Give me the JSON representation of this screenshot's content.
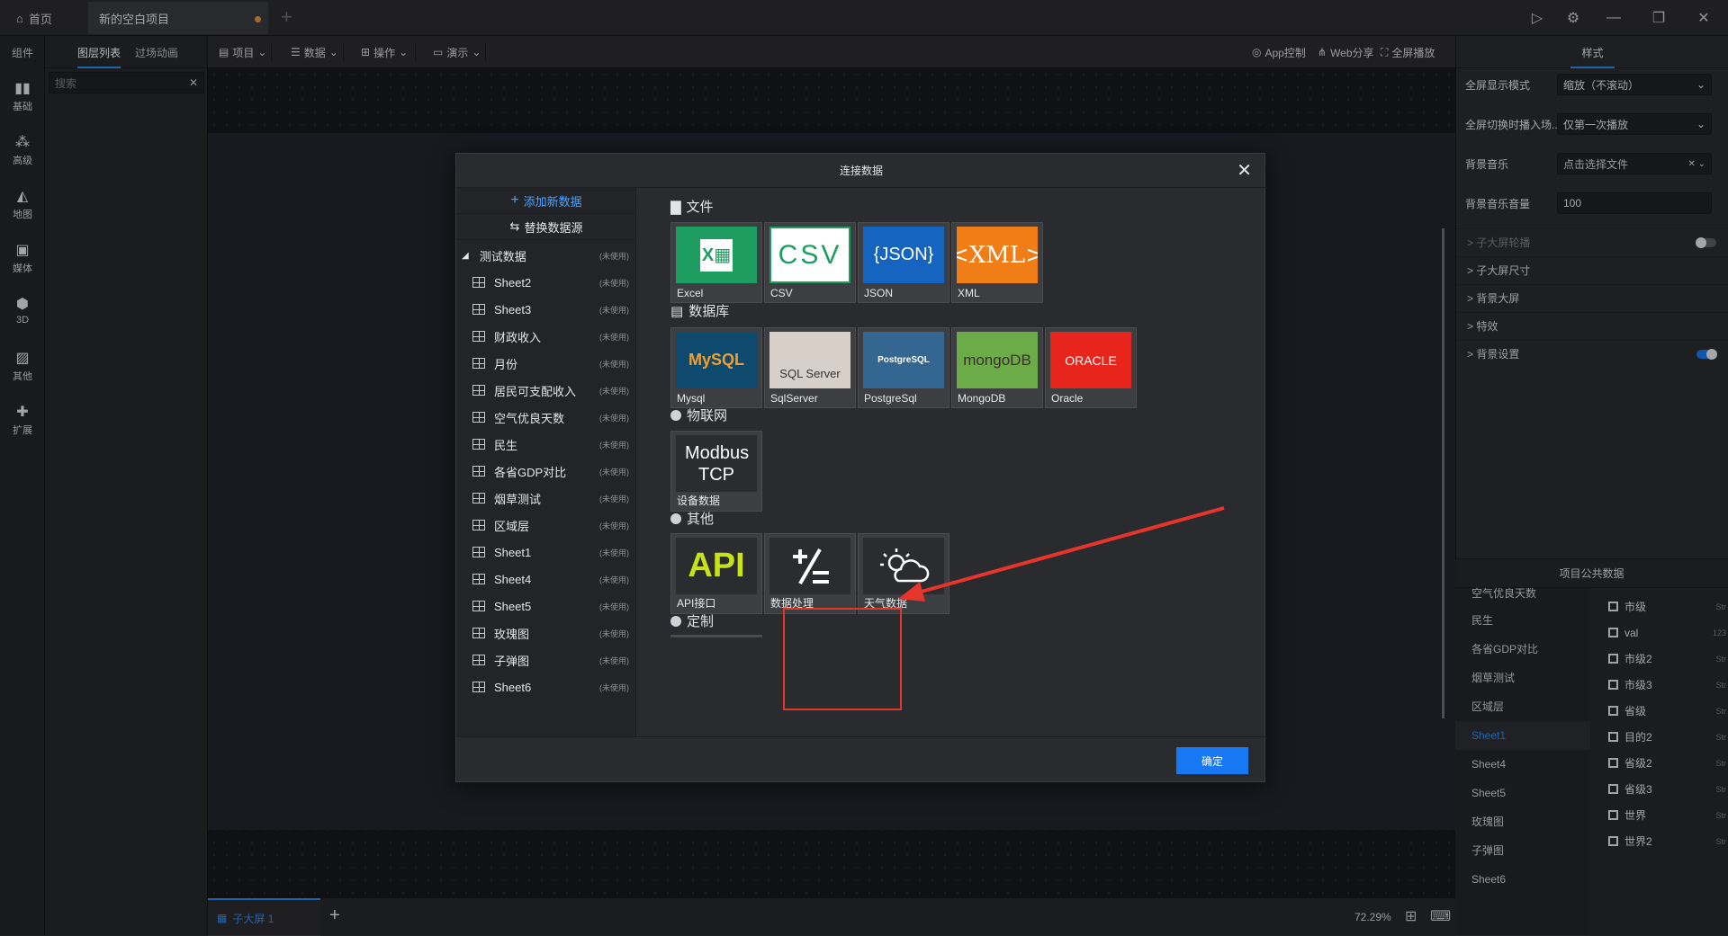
{
  "titlebar": {
    "home_label": "首页",
    "project_tab": "新的空白项目",
    "add_tab": "+"
  },
  "leftbar": {
    "title": "组件",
    "items": [
      {
        "label": "基础",
        "icon": "bar-chart-icon"
      },
      {
        "label": "高级",
        "icon": "scatter-icon"
      },
      {
        "label": "地图",
        "icon": "map-icon"
      },
      {
        "label": "媒体",
        "icon": "media-icon"
      },
      {
        "label": "3D",
        "icon": "cube-icon"
      },
      {
        "label": "其他",
        "icon": "image-icon"
      },
      {
        "label": "扩展",
        "icon": "puzzle-icon"
      }
    ]
  },
  "layerpanel": {
    "tab_layers": "图层列表",
    "tab_transition": "过场动画",
    "search_placeholder": "搜索"
  },
  "toolbar": {
    "project": "项目",
    "data": "数据",
    "operation": "操作",
    "demo": "演示",
    "app_control": "App控制",
    "web_share": "Web分享",
    "fullscreen": "全屏播放"
  },
  "bottombar": {
    "screen_tab": "子大屏 1",
    "add": "+",
    "zoom": "72.29%"
  },
  "rightpanel": {
    "tab_style": "样式",
    "rows": [
      {
        "label": "全屏显示模式",
        "value": "缩放（不滚动）"
      },
      {
        "label": "全屏切换时播入场...",
        "value": "仅第一次播放"
      },
      {
        "label": "背景音乐",
        "value": "点击选择文件"
      },
      {
        "label": "背景音乐音量",
        "value": "100"
      }
    ],
    "sections": [
      {
        "label": "> 子大屏轮播",
        "toggle": "off"
      },
      {
        "label": "> 子大屏尺寸"
      },
      {
        "label": "> 背景大屏"
      },
      {
        "label": "> 特效"
      },
      {
        "label": "> 背景设置",
        "toggle": "on"
      }
    ]
  },
  "commondata": {
    "title": "项目公共数据",
    "sources": [
      "空气优良天数",
      "民生",
      "各省GDP对比",
      "烟草测试",
      "区域层",
      "Sheet1",
      "Sheet4",
      "Sheet5",
      "玫瑰图",
      "子弹图",
      "Sheet6"
    ],
    "active_source": "Sheet1",
    "fields": [
      {
        "name": "市级",
        "type": "Str"
      },
      {
        "name": "val",
        "type": "123"
      },
      {
        "name": "市级2",
        "type": "Str"
      },
      {
        "name": "市级3",
        "type": "Str"
      },
      {
        "name": "省级",
        "type": "Str"
      },
      {
        "name": "目的2",
        "type": "Str"
      },
      {
        "name": "省级2",
        "type": "Str"
      },
      {
        "name": "省级3",
        "type": "Str"
      },
      {
        "name": "世界",
        "type": "Str"
      },
      {
        "name": "世界2",
        "type": "Str"
      }
    ]
  },
  "dialog": {
    "title": "连接数据",
    "add_new": "添加新数据",
    "replace_source": "替换数据源",
    "group": "测试数据",
    "unused": "(未使用)",
    "datasets": [
      "Sheet2",
      "Sheet3",
      "财政收入",
      "月份",
      "居民可支配收入",
      "空气优良天数",
      "民生",
      "各省GDP对比",
      "烟草测试",
      "区域层",
      "Sheet1",
      "Sheet4",
      "Sheet5",
      "玫瑰图",
      "子弹图",
      "Sheet6"
    ],
    "sections": {
      "file": "文件",
      "database": "数据库",
      "iot": "物联网",
      "other": "其他",
      "custom": "定制"
    },
    "file_cards": [
      "Excel",
      "CSV",
      "JSON",
      "XML"
    ],
    "db_cards": [
      "Mysql",
      "SqlServer",
      "PostgreSql",
      "MongoDB",
      "Oracle"
    ],
    "iot_cards": [
      "设备数据"
    ],
    "other_cards": [
      "API接口",
      "数据处理",
      "天气数据"
    ],
    "art_text": {
      "csv": "CSV",
      "json": "{JSON}",
      "xml": "<XML>",
      "mysql": "MySQL",
      "sqlserver": "SQL Server",
      "postgres": "PostgreSQL",
      "mongo": "mongoDB",
      "oracle": "ORACLE",
      "modbus": "Modbus TCP",
      "api": "API"
    },
    "confirm": "确定"
  },
  "colors": {
    "accent": "#1678f2",
    "highlight_box": "#e8352c",
    "excel": "#1d9d5f",
    "json": "#1565c0",
    "xml": "#f07d16",
    "mysql": "#0d4a6e",
    "postgres": "#336791",
    "mongo": "#6cac48",
    "oracle": "#e8251c"
  }
}
